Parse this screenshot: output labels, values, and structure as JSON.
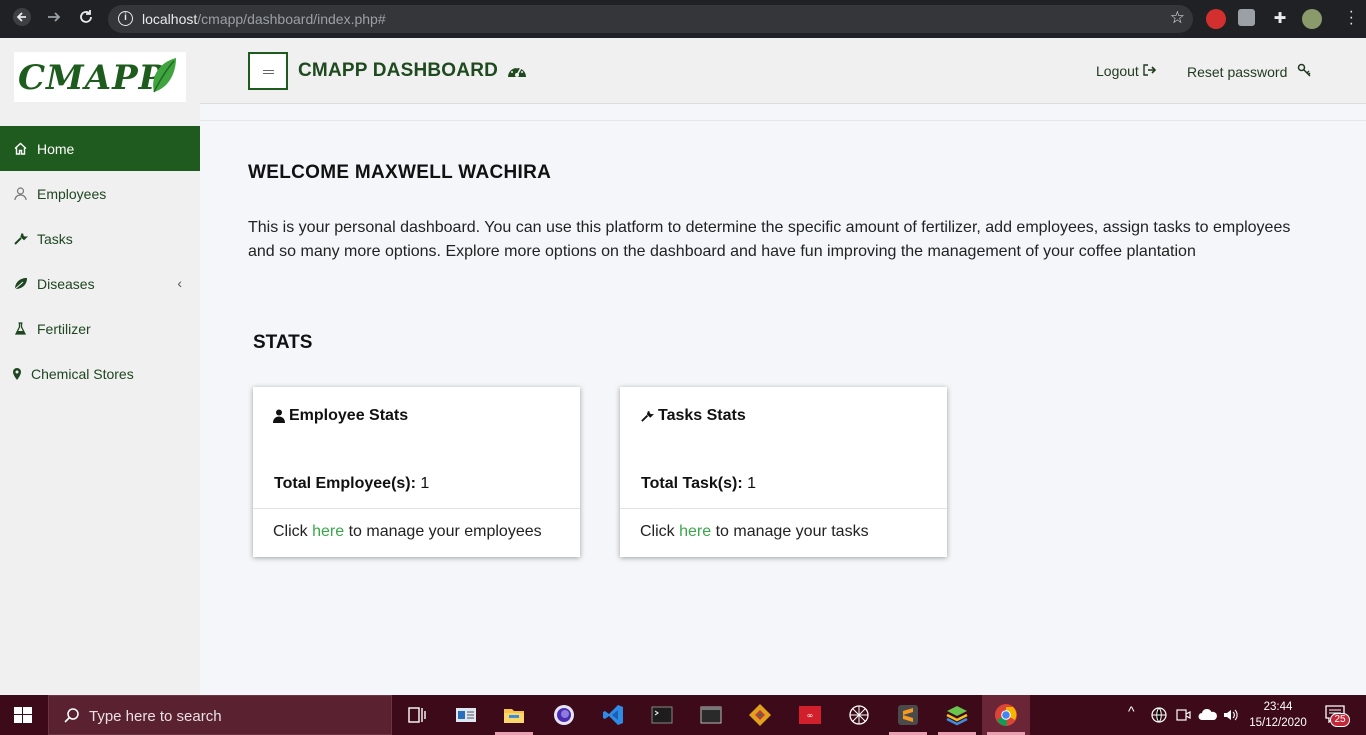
{
  "browser": {
    "url_host": "localhost",
    "url_path": "/cmapp/dashboard/index.php#"
  },
  "logo": {
    "text": "CMAPP"
  },
  "sidebar": {
    "items": [
      {
        "label": "Home",
        "icon": "home-icon",
        "active": true
      },
      {
        "label": "Employees",
        "icon": "user-icon"
      },
      {
        "label": "Tasks",
        "icon": "wrench-icon"
      },
      {
        "label": "Diseases",
        "icon": "leaf-icon",
        "has_submenu": true
      },
      {
        "label": "Fertilizer",
        "icon": "flask-icon"
      },
      {
        "label": "Chemical Stores",
        "icon": "map-marker-icon"
      }
    ]
  },
  "header": {
    "title": "CMAPP DASHBOARD",
    "logout": "Logout",
    "reset_password": "Reset password"
  },
  "main": {
    "welcome_prefix": "WELCOME",
    "user_name": "MAXWELL WACHIRA",
    "intro": "This is your personal dashboard. You can use this platform to determine the specific amount of fertilizer, add employees, assign tasks to employees and so many more options. Explore more options on the dashboard and have fun improving the management of your coffee plantation",
    "stats_title": "STATS",
    "cards": [
      {
        "title": "Employee Stats",
        "stat_label": "Total Employee(s):",
        "stat_value": "1",
        "foot_pre": "Click",
        "foot_link": "here",
        "foot_post": "to manage your employees"
      },
      {
        "title": "Tasks Stats",
        "stat_label": "Total Task(s):",
        "stat_value": "1",
        "foot_pre": "Click",
        "foot_link": "here",
        "foot_post": "to manage your tasks"
      }
    ]
  },
  "taskbar": {
    "search_placeholder": "Type here to search",
    "time": "23:44",
    "date": "15/12/2020",
    "notification_count": "25"
  },
  "colors": {
    "brand_green": "#1f5a1f",
    "link_green": "#3aa74a",
    "taskbar": "#3c0a18"
  }
}
